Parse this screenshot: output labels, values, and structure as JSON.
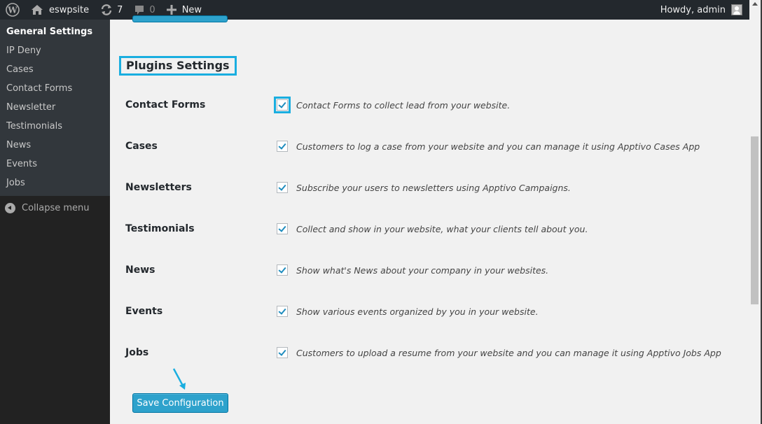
{
  "adminbar": {
    "site_name": "eswpsite",
    "updates_count": "7",
    "comments_count": "0",
    "new_label": "New",
    "greeting": "Howdy, admin"
  },
  "sidebar": {
    "items": [
      {
        "label": "General Settings",
        "current": true
      },
      {
        "label": "IP Deny"
      },
      {
        "label": "Cases"
      },
      {
        "label": "Contact Forms"
      },
      {
        "label": "Newsletter"
      },
      {
        "label": "Testimonials"
      },
      {
        "label": "News"
      },
      {
        "label": "Events"
      },
      {
        "label": "Jobs"
      }
    ],
    "collapse_label": "Collapse menu"
  },
  "main": {
    "section_title": "Plugins Settings",
    "plugins": [
      {
        "label": "Contact Forms",
        "checked": true,
        "description": "Contact Forms to collect lead from your website."
      },
      {
        "label": "Cases",
        "checked": true,
        "description": "Customers to log a case from your website and you can manage it using Apptivo Cases App"
      },
      {
        "label": "Newsletters",
        "checked": true,
        "description": "Subscribe your users to newsletters using Apptivo Campaigns."
      },
      {
        "label": "Testimonials",
        "checked": true,
        "description": "Collect and show in your website, what your clients tell about you."
      },
      {
        "label": "News",
        "checked": true,
        "description": "Show what's News about your company in your websites."
      },
      {
        "label": "Events",
        "checked": true,
        "description": "Show various events organized by you in your website."
      },
      {
        "label": "Jobs",
        "checked": true,
        "description": "Customers to upload a resume from your website and you can manage it using Apptivo Jobs App"
      }
    ],
    "save_label": "Save Configuration"
  },
  "colors": {
    "highlight": "#1aaee0",
    "button": "#2ea2cc",
    "adminbar": "#23282d",
    "sidebar": "#32373c"
  }
}
